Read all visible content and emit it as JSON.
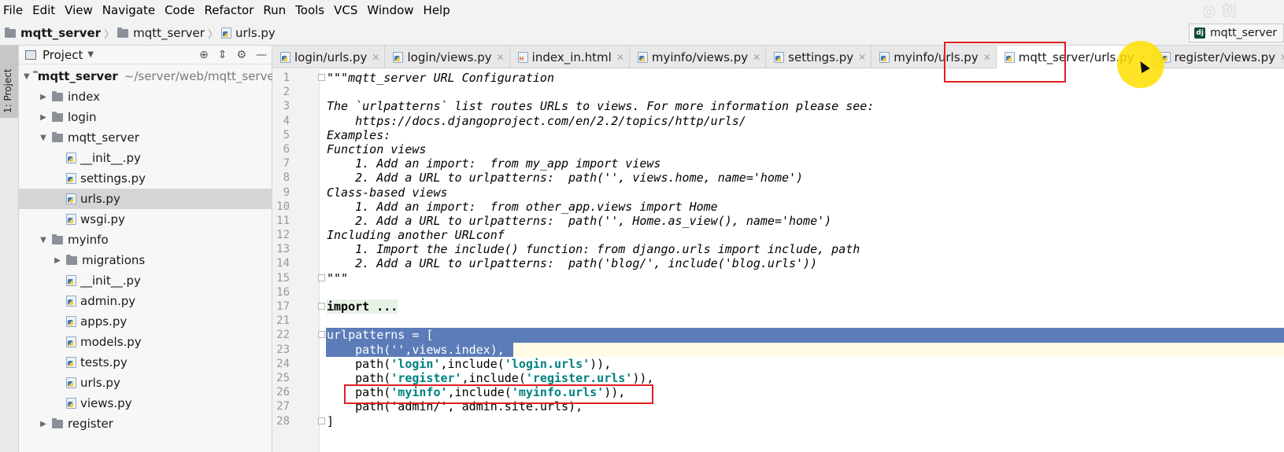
{
  "menu": [
    "File",
    "Edit",
    "View",
    "Navigate",
    "Code",
    "Refactor",
    "Run",
    "Tools",
    "VCS",
    "Window",
    "Help"
  ],
  "breadcrumb": [
    "mqtt_server",
    "mqtt_server",
    "urls.py"
  ],
  "run_config": "mqtt_server",
  "toolstrip_label": "1: Project",
  "project_panel": {
    "title": "Project",
    "root": {
      "name": "mqtt_server",
      "path": "~/server/web/mqtt_server"
    },
    "items": [
      {
        "name": "index",
        "kind": "folder",
        "depth": 1,
        "state": "collapsed"
      },
      {
        "name": "login",
        "kind": "folder",
        "depth": 1,
        "state": "collapsed"
      },
      {
        "name": "mqtt_server",
        "kind": "folder",
        "depth": 1,
        "state": "expanded"
      },
      {
        "name": "__init__.py",
        "kind": "py",
        "depth": 2
      },
      {
        "name": "settings.py",
        "kind": "py",
        "depth": 2
      },
      {
        "name": "urls.py",
        "kind": "py",
        "depth": 2,
        "selected": true
      },
      {
        "name": "wsgi.py",
        "kind": "py",
        "depth": 2
      },
      {
        "name": "myinfo",
        "kind": "folder",
        "depth": 1,
        "state": "expanded"
      },
      {
        "name": "migrations",
        "kind": "folder",
        "depth": 2,
        "state": "collapsed"
      },
      {
        "name": "__init__.py",
        "kind": "py",
        "depth": 2
      },
      {
        "name": "admin.py",
        "kind": "py",
        "depth": 2
      },
      {
        "name": "apps.py",
        "kind": "py",
        "depth": 2
      },
      {
        "name": "models.py",
        "kind": "py",
        "depth": 2
      },
      {
        "name": "tests.py",
        "kind": "py",
        "depth": 2
      },
      {
        "name": "urls.py",
        "kind": "py",
        "depth": 2
      },
      {
        "name": "views.py",
        "kind": "py",
        "depth": 2
      },
      {
        "name": "register",
        "kind": "folder",
        "depth": 1,
        "state": "collapsed"
      }
    ]
  },
  "tabs": [
    {
      "label": "login/urls.py",
      "icon": "py"
    },
    {
      "label": "login/views.py",
      "icon": "py"
    },
    {
      "label": "index_in.html",
      "icon": "html"
    },
    {
      "label": "myinfo/views.py",
      "icon": "py"
    },
    {
      "label": "settings.py",
      "icon": "py"
    },
    {
      "label": "myinfo/urls.py",
      "icon": "py"
    },
    {
      "label": "mqtt_server/urls.py",
      "icon": "py",
      "active": true
    },
    {
      "label": "register/views.py",
      "icon": "py"
    }
  ],
  "code": [
    {
      "n": "1",
      "t": "\"\"\"mqtt_server URL Configuration",
      "style": "doc"
    },
    {
      "n": "2",
      "t": "",
      "style": "doc"
    },
    {
      "n": "3",
      "t": "The `urlpatterns` list routes URLs to views. For more information please see:",
      "style": "doc"
    },
    {
      "n": "4",
      "t": "    https://docs.djangoproject.com/en/2.2/topics/http/urls/",
      "style": "doc"
    },
    {
      "n": "5",
      "t": "Examples:",
      "style": "doc"
    },
    {
      "n": "6",
      "t": "Function views",
      "style": "doc"
    },
    {
      "n": "7",
      "t": "    1. Add an import:  from my_app import views",
      "style": "doc"
    },
    {
      "n": "8",
      "t": "    2. Add a URL to urlpatterns:  path('', views.home, name='home')",
      "style": "doc"
    },
    {
      "n": "9",
      "t": "Class-based views",
      "style": "doc"
    },
    {
      "n": "10",
      "t": "    1. Add an import:  from other_app.views import Home",
      "style": "doc"
    },
    {
      "n": "11",
      "t": "    2. Add a URL to urlpatterns:  path('', Home.as_view(), name='home')",
      "style": "doc"
    },
    {
      "n": "12",
      "t": "Including another URLconf",
      "style": "doc"
    },
    {
      "n": "13",
      "t": "    1. Import the include() function: from django.urls import include, path",
      "style": "doc"
    },
    {
      "n": "14",
      "t": "    2. Add a URL to urlpatterns:  path('blog/', include('blog.urls'))",
      "style": "doc"
    },
    {
      "n": "15",
      "t": "\"\"\"",
      "style": "doc"
    },
    {
      "n": "16",
      "t": "",
      "style": "plain"
    },
    {
      "n": "17",
      "t": "import ...",
      "style": "import"
    },
    {
      "n": "21",
      "t": "",
      "style": "plain"
    },
    {
      "n": "22",
      "t": "urlpatterns = [",
      "style": "sel"
    },
    {
      "n": "23",
      "t": "    path('',views.index),",
      "style": "partsel"
    },
    {
      "n": "24",
      "pre": "    path(",
      "s1": "'login'",
      "mid": ",include(",
      "s2": "'login.urls'",
      "post": ")),",
      "style": "path"
    },
    {
      "n": "25",
      "pre": "    path(",
      "s1": "'register'",
      "mid": ",include(",
      "s2": "'register.urls'",
      "post": ")),",
      "style": "path"
    },
    {
      "n": "26",
      "pre": "    path(",
      "s1": "'myinfo'",
      "mid": ",include(",
      "s2": "'myinfo.urls'",
      "post": ")),",
      "style": "path"
    },
    {
      "n": "27",
      "t": "    path('admin/', admin.site.urls),",
      "style": "plain"
    },
    {
      "n": "28",
      "t": "]",
      "style": "plain"
    }
  ]
}
